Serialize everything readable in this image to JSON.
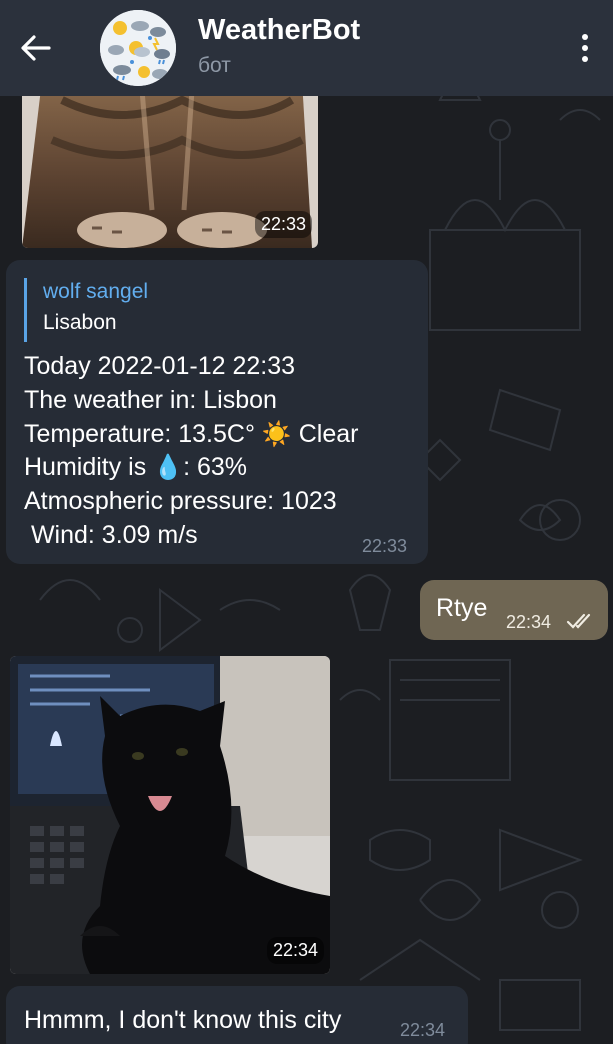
{
  "header": {
    "back_icon": "arrow-left-icon",
    "title": "WeatherBot",
    "subtitle": "бот",
    "menu_icon": "more-vertical-icon"
  },
  "messages": {
    "photo1": {
      "time": "22:33",
      "content": "tabby cat photo"
    },
    "weather": {
      "reply_name": "wolf sangel",
      "reply_text": "Lisabon",
      "line1": "Today 2022-01-12 22:33",
      "line2": "The weather in: Lisbon",
      "line3_prefix": "Temperature: 13.5C°",
      "line3_emoji": "☀️",
      "line3_suffix": "Clear",
      "line4_prefix": "Humidity is",
      "line4_emoji": "💧",
      "line4_suffix": ": 63%",
      "line5": "Atmospheric pressure: 1023",
      "line6": " Wind: 3.09 m/s",
      "time": "22:33"
    },
    "outgoing": {
      "text": "Rtye",
      "time": "22:34",
      "status_icon": "double-check-icon"
    },
    "photo2": {
      "time": "22:34",
      "content": "black cat on laptop photo"
    },
    "last": {
      "text": "Hmmm, I don't know this city",
      "time": "22:34"
    }
  },
  "colors": {
    "header_bg": "#2b313c",
    "chat_bg": "#1c1e22",
    "incoming_bubble": "#262c36",
    "outgoing_bubble": "#6f6653",
    "accent": "#62aeef"
  }
}
